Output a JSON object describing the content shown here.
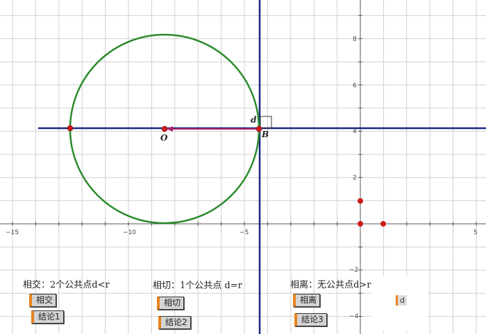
{
  "axes": {
    "x_ticks": [
      "−15",
      "−10",
      "−5",
      "5"
    ],
    "y_ticks": [
      "8",
      "6",
      "4",
      "2",
      "−2",
      "−4"
    ]
  },
  "labels": {
    "center": "O",
    "tangent_point": "B",
    "distance": "d"
  },
  "captions": {
    "intersect": "相交：2个公共点d<r",
    "tangent": "相切：1个公共点 d=r",
    "separate": "相离：无公共点d>r"
  },
  "buttons": {
    "intersect": "相交",
    "conclusion1": "结论1",
    "tangent": "相切",
    "conclusion2": "结论2",
    "separate": "相离",
    "conclusion3": "结论3",
    "extra": "d"
  },
  "colors": {
    "circle": "#2a8a2a",
    "line": "#1a2580",
    "vector": "#b0206a",
    "point": "#cc1a1a",
    "button_accent": "#e8821e"
  }
}
